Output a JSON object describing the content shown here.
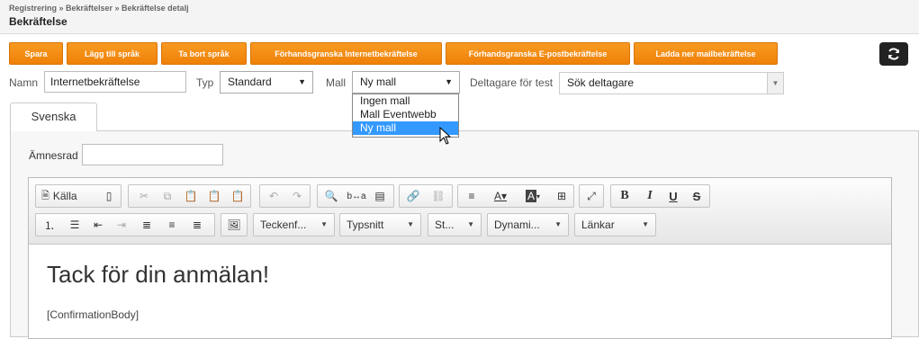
{
  "header": {
    "breadcrumb": "Registrering » Bekräftelser » Bekräftelse detalj",
    "title": "Bekräftelse"
  },
  "actions": {
    "save": "Spara",
    "add_language": "Lägg till språk",
    "remove_language": "Ta bort språk",
    "preview_internet": "Förhandsgranska Internetbekräftelse",
    "preview_email": "Förhandsgranska E-postbekräftelse",
    "download_mail": "Ladda ner mailbekräftelse",
    "refresh_icon": "refresh-icon"
  },
  "form": {
    "name_label": "Namn",
    "name_value": "Internetbekräftelse",
    "type_label": "Typ",
    "type_value": "Standard",
    "template_label": "Mall",
    "template_value": "Ny mall",
    "template_options": [
      "Ingen mall",
      "Mall Eventwebb",
      "Ny mall"
    ],
    "test_label": "Deltagare för test",
    "test_placeholder": "Sök deltagare"
  },
  "tabs": {
    "active": "Svenska"
  },
  "subject": {
    "label": "Ämnesrad",
    "value": ""
  },
  "editor": {
    "source_label": "Källa",
    "combos": [
      "Teckenf...",
      "Typsnitt",
      "St...",
      "Dynami...",
      "Länkar"
    ],
    "content_title": "Tack för din anmälan!",
    "content_body": "[ConfirmationBody]"
  }
}
